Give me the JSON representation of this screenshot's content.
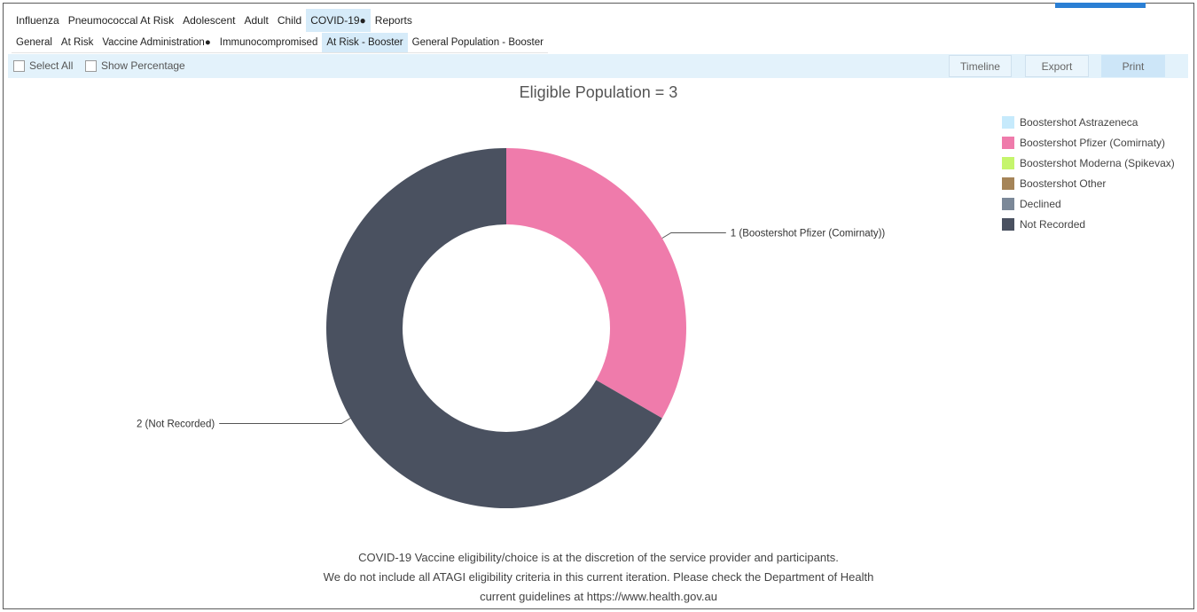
{
  "tabs_main": [
    {
      "label": "Influenza",
      "active": false
    },
    {
      "label": "Pneumococcal At Risk",
      "active": false
    },
    {
      "label": "Adolescent",
      "active": false
    },
    {
      "label": "Adult",
      "active": false
    },
    {
      "label": "Child",
      "active": false
    },
    {
      "label": "COVID-19●",
      "active": true
    },
    {
      "label": "Reports",
      "active": false
    }
  ],
  "tabs_sub": [
    {
      "label": "General",
      "active": false
    },
    {
      "label": "At Risk",
      "active": false
    },
    {
      "label": "Vaccine Administration●",
      "active": false
    },
    {
      "label": "Immunocompromised",
      "active": false
    },
    {
      "label": "At Risk - Booster",
      "active": true
    },
    {
      "label": "General Population - Booster",
      "active": false
    }
  ],
  "toolbar": {
    "select_all": "Select All",
    "show_percentage": "Show Percentage",
    "timeline": "Timeline",
    "export": "Export",
    "print": "Print"
  },
  "chart_data": {
    "type": "pie",
    "title": "Eligible Population = 3",
    "donut": true,
    "series": [
      {
        "name": "Boostershot Astrazeneca",
        "value": 0,
        "color": "#c6eafc"
      },
      {
        "name": "Boostershot Pfizer (Comirnaty)",
        "value": 1,
        "color": "#ef7bab"
      },
      {
        "name": "Boostershot Moderna (Spikevax)",
        "value": 0,
        "color": "#c5f56c"
      },
      {
        "name": "Boostershot Other",
        "value": 0,
        "color": "#a58458"
      },
      {
        "name": "Declined",
        "value": 0,
        "color": "#7b8898"
      },
      {
        "name": "Not Recorded",
        "value": 2,
        "color": "#4a5160"
      }
    ],
    "data_labels": [
      "1 (Boostershot Pfizer (Comirnaty))",
      "2 (Not Recorded)"
    ],
    "legend_position": "top-right"
  },
  "footer_lines": [
    "COVID-19 Vaccine eligibility/choice is at the discretion of the service provider and participants.",
    "We do not include all ATAGI eligibility criteria in this current iteration. Please check the Department of Health",
    "current guidelines at https://www.health.gov.au"
  ]
}
